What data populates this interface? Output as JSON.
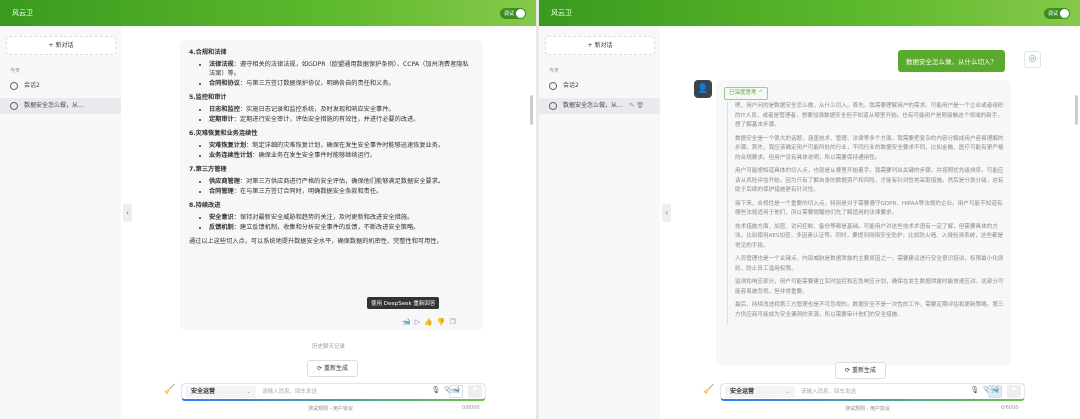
{
  "app": {
    "title": "风云卫",
    "debug_label": "调试"
  },
  "sidebar": {
    "new_chat": "+ 新对话",
    "section_today": "今天",
    "conversations": [
      {
        "label": "会话2"
      },
      {
        "label": "数据安全怎么做，从..."
      }
    ]
  },
  "left_answer": {
    "sections": [
      {
        "title": "4.合规和法律",
        "items": [
          {
            "k": "法律法规",
            "v": "：遵守相关的法律法规，如GDPR（欧盟通用数据保护条例）、CCPA（加州消费者隐私法案）等。"
          },
          {
            "k": "合同和协议",
            "v": "：与第三方签订数据保护协议，明确各自的责任和义务。"
          }
        ]
      },
      {
        "title": "5.监控和审计",
        "items": [
          {
            "k": "日志和监控",
            "v": "：实施日志记录和监控系统，及时发现和响应安全事件。"
          },
          {
            "k": "定期审计",
            "v": "：定期进行安全审计，评估安全措施的有效性，并进行必要的改进。"
          }
        ]
      },
      {
        "title": "6.灾难恢复和业务连续性",
        "items": [
          {
            "k": "灾难恢复计划",
            "v": "：制定详细的灾难恢复计划，确保在发生安全事件时能够迅速恢复业务。"
          },
          {
            "k": "业务连续性计划",
            "v": "：确保业务在发生安全事件时能够继续运行。"
          }
        ]
      },
      {
        "title": "7.第三方管理",
        "items": [
          {
            "k": "供应商管理",
            "v": "：对第三方供应商进行严格的安全评估，确保他们能够满足数据安全要求。"
          },
          {
            "k": "合同管理",
            "v": "：在与第三方签订合同时，明确数据安全条款和责任。"
          }
        ]
      },
      {
        "title": "8.持续改进",
        "items": [
          {
            "k": "安全意识",
            "v": "：保持对最新安全威胁和趋势的关注，及时更新和改进安全措施。"
          },
          {
            "k": "反馈机制",
            "v": "：建立反馈机制，收集和分析安全事件的反馈，不断改进安全策略。"
          }
        ]
      }
    ],
    "conclusion": "通过以上这些切入点，可以系统地提升数据安全水平，确保数据的机密性、完整性和可用性。",
    "tooltip": "使用 DeepSeek 重新回答"
  },
  "history_label": "历史聊天记录",
  "regenerate_label": "重新生成",
  "input": {
    "mode": "安全运营",
    "placeholder": "请输入消息，回车发送",
    "count": "0/6000"
  },
  "footer": {
    "text": "测试规则 - 用户协议"
  },
  "right_chat": {
    "user_message": "数据安全怎么做，从什么切入？",
    "think_label": "已深度思考",
    "thoughts": [
      "嗯，用户问的是数据安全怎么做，从什么切入。首先，我需要理解用户的需求。可能用户是一个企业或者组织的IT人员，或者是管理者，想要加强数据安全但不知道从哪里开始。也有可能用户是刚接触这个领域的新手，想了解基本步骤。",
      "数据安全是一个很大的话题，涵盖技术、管理、法律等多个方面。我需要把复杂的内容分解成用户容易理解的步骤。首先，我应该确定用户可能所处的行业，不同行业的数据安全要求不同，比如金融、医疗可能有更严格的合规要求。但用户没有具体说明，所以需要保持通用性。",
      "用户可能想知道具体的切入点，也就是从哪里开始着手。我需要列出关键的步骤，并按照优先级排序。可能应该从风险评估开始，因为只有了解自身的数据资产和风险，才能有针对性地采取措施。然后是分类分级，这有助于后续的保护措施更有针对性。",
      "接下来，合规性是一个重要的切入点，特别是对于需要遵守GDPR、HIPAA等法规的企业。用户可能不知道有哪些法规适用于他们，所以需要提醒他们先了解适用的法律要求。",
      "技术措施方面，加密、访问控制、备份等都是基础。可能用户对这些技术术语有一定了解，但需要具体的方法，比如使用AES加密，多因素认证等。同时，要提到网络安全防护，比如防火墙、入侵检测系统，这些都是常见的手段。",
      "人员管理也是一个关键点，内部威胁是数据泄露的主要原因之一。需要建议进行安全意识培训，权限最小化原则，防止员工滥用权限。",
      "监测和响应部分，用户可能需要建立实时监控和应急响应计划，确保在发生数据泄露时能快速应对。这部分可能容易被忽视，但非常重要。",
      "最后，持续改进和第三方管理也是不可忽视的。数据安全不是一次性的工作，需要定期评估和更新策略。第三方供应商可能成为安全漏洞的来源，所以需要审计他们的安全措施。"
    ]
  }
}
